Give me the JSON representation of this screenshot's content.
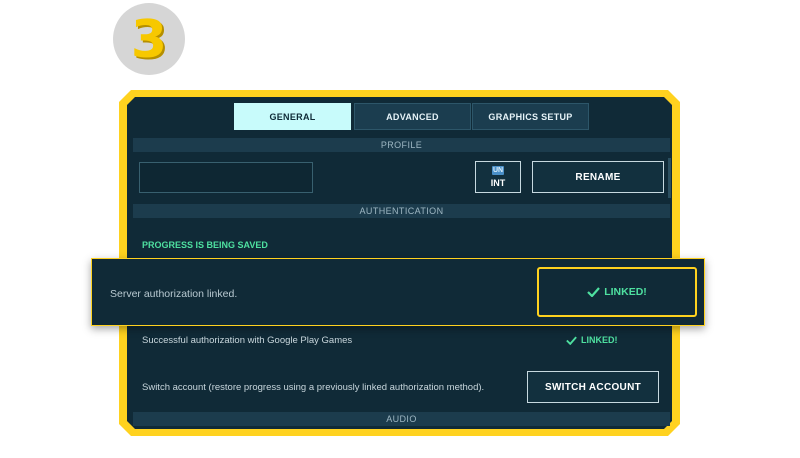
{
  "step_number": "3",
  "tabs": [
    {
      "label": "GENERAL",
      "active": true
    },
    {
      "label": "ADVANCED",
      "active": false
    },
    {
      "label": "GRAPHICS SETUP",
      "active": false
    }
  ],
  "sections": {
    "profile": "PROFILE",
    "authentication": "AUTHENTICATION",
    "audio": "AUDIO"
  },
  "profile": {
    "name_value": "",
    "region_label": "INT",
    "region_icon": "UN",
    "rename_label": "RENAME"
  },
  "auth": {
    "progress_status": "PROGRESS IS BEING SAVED",
    "server_text": "Server authorization linked.",
    "server_status": "LINKED!",
    "google_text": "Successful authorization with Google Play Games",
    "google_status": "LINKED!",
    "switch_text": "Switch account (restore progress using a previously linked authorization method).",
    "switch_label": "SWITCH ACCOUNT"
  },
  "colors": {
    "accent_yellow": "#ffd21f",
    "panel_bg": "#102a37",
    "linked_green": "#4ee0a0",
    "active_tab": "#c8fbfb"
  }
}
